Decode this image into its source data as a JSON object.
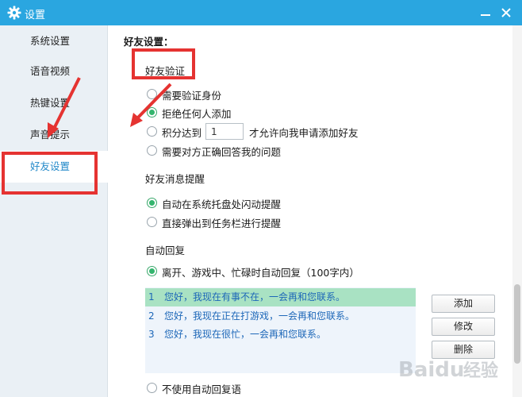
{
  "window": {
    "title": "设置"
  },
  "sidebar": {
    "items": [
      {
        "label": "系统设置"
      },
      {
        "label": "语音视频"
      },
      {
        "label": "热键设置"
      },
      {
        "label": "声音提示"
      },
      {
        "label": "好友设置"
      }
    ],
    "active_index": 4
  },
  "content": {
    "header": "好友设置：",
    "verify": {
      "title": "好友验证",
      "options": [
        {
          "label": "需要验证身份",
          "selected": false
        },
        {
          "label": "拒绝任何人添加",
          "selected": true
        },
        {
          "label_before": "积分达到",
          "input_value": "1",
          "label_after": "才允许向我申请添加好友",
          "selected": false
        },
        {
          "label": "需要对方正确回答我的问题",
          "selected": false
        }
      ]
    },
    "notify": {
      "title": "好友消息提醒",
      "options": [
        {
          "label": "自动在系统托盘处闪动提醒",
          "selected": true
        },
        {
          "label": "直接弹出到任务栏进行提醒",
          "selected": false
        }
      ]
    },
    "autoreply": {
      "title": "自动回复",
      "enable_option": {
        "label": "离开、游戏中、忙碌时自动回复（100字内）",
        "selected": true
      },
      "replies": [
        {
          "num": "1",
          "text": "您好，我现在有事不在，一会再和您联系。"
        },
        {
          "num": "2",
          "text": "您好，我现在正在打游戏，一会再和您联系。"
        },
        {
          "num": "3",
          "text": "您好，我现在很忙，一会再和您联系。"
        }
      ],
      "selected_reply": 0,
      "buttons": {
        "add": "添加",
        "edit": "修改",
        "delete": "删除"
      },
      "disable_option": {
        "label": "不使用自动回复语",
        "selected": false
      }
    }
  },
  "watermark": {
    "text": "Baidu经验"
  },
  "colors": {
    "titlebar": "#2aa6e0",
    "accent": "#2289c9",
    "radio_on": "#34b56e",
    "annotation": "#e53331",
    "selected_row": "#a9e2c3"
  }
}
